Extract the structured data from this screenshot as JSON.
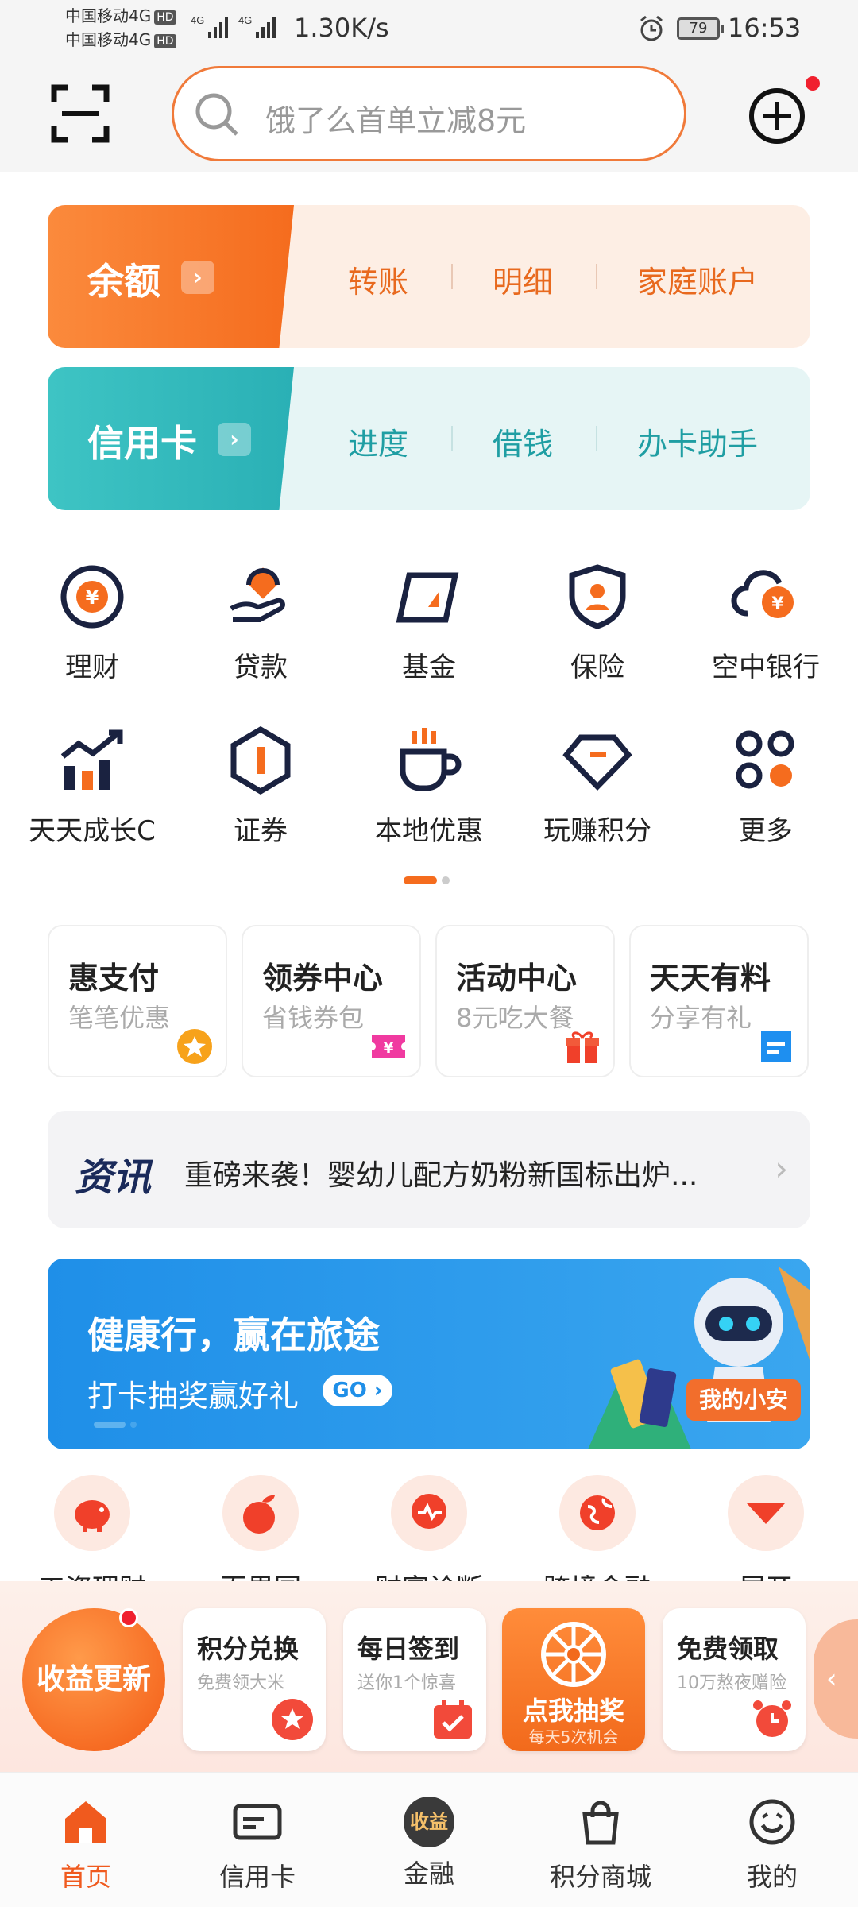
{
  "status_bar": {
    "carrier1": "中国移动4G",
    "carrier2": "中国移动4G",
    "hd": "HD",
    "net": "4G",
    "speed": "1.30K/s",
    "battery": "79",
    "time": "16:53"
  },
  "search": {
    "placeholder": "饿了么首单立减8元"
  },
  "balance_card": {
    "title": "余额",
    "links": [
      "转账",
      "明细",
      "家庭账户"
    ],
    "accent": "#f56c1e"
  },
  "credit_card": {
    "title": "信用卡",
    "links": [
      "进度",
      "借钱",
      "办卡助手"
    ],
    "accent": "#1f9ea3"
  },
  "grid": [
    {
      "label": "理财",
      "icon": "yuan-coin-icon"
    },
    {
      "label": "贷款",
      "icon": "hand-coin-icon"
    },
    {
      "label": "基金",
      "icon": "fund-icon"
    },
    {
      "label": "保险",
      "icon": "shield-person-icon"
    },
    {
      "label": "空中银行",
      "icon": "cloud-yuan-icon"
    },
    {
      "label": "天天成长C",
      "icon": "growth-chart-icon"
    },
    {
      "label": "证券",
      "icon": "securities-hexagon-icon"
    },
    {
      "label": "本地优惠",
      "icon": "coffee-cup-icon"
    },
    {
      "label": "玩赚积分",
      "icon": "diamond-icon"
    },
    {
      "label": "更多",
      "icon": "more-dots-icon"
    }
  ],
  "promos": [
    {
      "title": "惠支付",
      "subtitle": "笔笔优惠"
    },
    {
      "title": "领券中心",
      "subtitle": "省钱券包"
    },
    {
      "title": "活动中心",
      "subtitle": "8元吃大餐"
    },
    {
      "title": "天天有料",
      "subtitle": "分享有礼"
    }
  ],
  "news": {
    "tag": "资讯",
    "text": "重磅来袭！婴幼儿配方奶粉新国标出炉..."
  },
  "banner": {
    "title": "健康行，赢在旅途",
    "subtitle": "打卡抽奖赢好礼",
    "go": "GO",
    "assistant": "我的小安"
  },
  "circle_row": [
    "工资理财",
    "百果园",
    "财富诊断",
    "跨境金融",
    "展开"
  ],
  "float_bar": {
    "earn": "收益更新",
    "cards": [
      {
        "title": "积分兑换",
        "subtitle": "免费领大米"
      },
      {
        "title": "每日签到",
        "subtitle": "送你1个惊喜"
      },
      {
        "title": "点我抽奖",
        "subtitle": "每天5次机会"
      },
      {
        "title": "免费领取",
        "subtitle": "10万熬夜赠险"
      }
    ]
  },
  "tabs": [
    {
      "label": "首页",
      "active": true
    },
    {
      "label": "信用卡"
    },
    {
      "label": "金融",
      "badge": "收益"
    },
    {
      "label": "积分商城"
    },
    {
      "label": "我的"
    }
  ]
}
